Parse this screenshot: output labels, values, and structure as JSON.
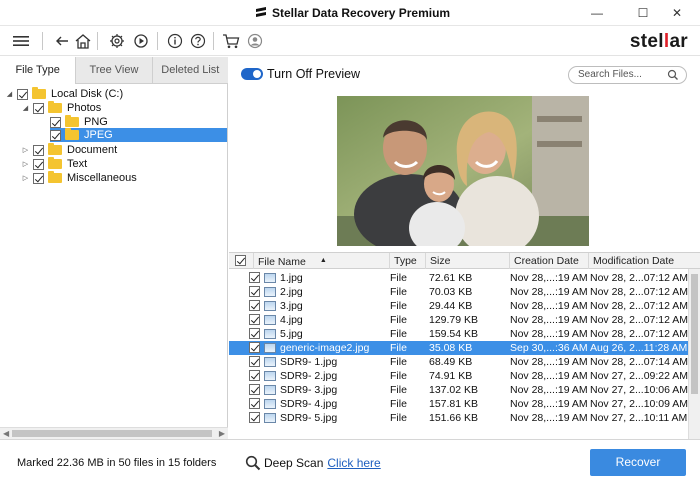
{
  "window": {
    "title": "Stellar Data Recovery Premium",
    "min_glyph": "—",
    "max_glyph": "☐",
    "close_glyph": "✕"
  },
  "toolbar": {
    "icons": [
      "menu-icon",
      "back-icon",
      "home-icon",
      "settings-icon",
      "play-icon",
      "info-icon",
      "help-icon",
      "cart-icon",
      "account-icon"
    ],
    "brand_main": "stel",
    "brand_accent": "l",
    "brand_tail": "ar"
  },
  "left_tabs": [
    "File Type",
    "Tree View",
    "Deleted List"
  ],
  "tree": [
    {
      "label": "Local Disk (C:)",
      "expander": "◢",
      "checked": true
    },
    {
      "label": "Photos",
      "expander": "◢",
      "checked": true
    },
    {
      "label": "PNG",
      "expander": "",
      "checked": true
    },
    {
      "label": "JPEG",
      "expander": "",
      "checked": true,
      "selected": true
    },
    {
      "label": "Document",
      "expander": "▷",
      "checked": true
    },
    {
      "label": "Text",
      "expander": "▷",
      "checked": true
    },
    {
      "label": "Miscellaneous",
      "expander": "▷",
      "checked": true
    }
  ],
  "preview": {
    "toggle_label": "Turn Off Preview",
    "search_placeholder": "Search Files..."
  },
  "file_table": {
    "columns": [
      "File Name",
      "Type",
      "Size",
      "Creation Date",
      "Modification Date"
    ],
    "sort_arrow": "▲",
    "rows": [
      {
        "name": "1.jpg",
        "type": "File",
        "size": "72.61 KB",
        "created": "Nov 28,...:19 AM",
        "modified": "Nov 28, 2...07:12 AM"
      },
      {
        "name": "2.jpg",
        "type": "File",
        "size": "70.03 KB",
        "created": "Nov 28,...:19 AM",
        "modified": "Nov 28, 2...07:12 AM"
      },
      {
        "name": "3.jpg",
        "type": "File",
        "size": "29.44 KB",
        "created": "Nov 28,...:19 AM",
        "modified": "Nov 28, 2...07:12 AM"
      },
      {
        "name": "4.jpg",
        "type": "File",
        "size": "129.79 KB",
        "created": "Nov 28,...:19 AM",
        "modified": "Nov 28, 2...07:12 AM"
      },
      {
        "name": "5.jpg",
        "type": "File",
        "size": "159.54 KB",
        "created": "Nov 28,...:19 AM",
        "modified": "Nov 28, 2...07:12 AM"
      },
      {
        "name": "generic-image2.jpg",
        "type": "File",
        "size": "35.08 KB",
        "created": "Sep 30,...:36 AM",
        "modified": "Aug 26, 2...11:28 AM",
        "selected": true
      },
      {
        "name": "SDR9- 1.jpg",
        "type": "File",
        "size": "68.49 KB",
        "created": "Nov 28,...:19 AM",
        "modified": "Nov 28, 2...07:14 AM"
      },
      {
        "name": "SDR9- 2.jpg",
        "type": "File",
        "size": "74.91 KB",
        "created": "Nov 28,...:19 AM",
        "modified": "Nov 27, 2...09:22 AM"
      },
      {
        "name": "SDR9- 3.jpg",
        "type": "File",
        "size": "137.02 KB",
        "created": "Nov 28,...:19 AM",
        "modified": "Nov 27, 2...10:06 AM"
      },
      {
        "name": "SDR9- 4.jpg",
        "type": "File",
        "size": "157.81 KB",
        "created": "Nov 28,...:19 AM",
        "modified": "Nov 27, 2...10:09 AM"
      },
      {
        "name": "SDR9- 5.jpg",
        "type": "File",
        "size": "151.66 KB",
        "created": "Nov 28,...:19 AM",
        "modified": "Nov 27, 2...10:11 AM"
      }
    ]
  },
  "footer": {
    "status": "Marked 22.36 MB in 50 files in 15 folders",
    "deep_scan_label": "Deep Scan",
    "deep_scan_link": "Click here",
    "recover_label": "Recover"
  },
  "colors": {
    "accent": "#3a8ae0",
    "selection": "#3c8fe6",
    "brand_red": "#e0202a"
  }
}
